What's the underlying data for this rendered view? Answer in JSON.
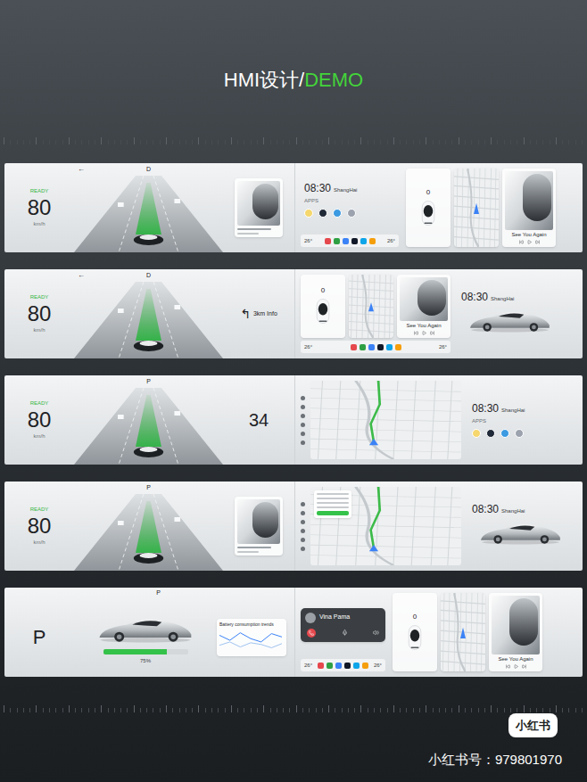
{
  "title": {
    "main": "HMI设计/",
    "accent": "DEMO"
  },
  "dock": {
    "temp_left": "26°",
    "temp_right": "26°",
    "apps": [
      {
        "color": "#e5484d"
      },
      {
        "color": "#2ea043"
      },
      {
        "color": "#3b82f6"
      },
      {
        "color": "#111827"
      },
      {
        "color": "#0ea5e9"
      },
      {
        "color": "#f59e0b"
      }
    ]
  },
  "home_apps": {
    "label": "APPS",
    "apps": [
      {
        "color": "#f5d76e"
      },
      {
        "color": "#1f2937"
      },
      {
        "color": "#3b9ae1"
      },
      {
        "color": "#9ca3af"
      }
    ]
  },
  "screens": [
    {
      "cluster": {
        "kind": "drive",
        "top_gear": "D",
        "arrow": "←",
        "status": "READY",
        "speed": "80",
        "unit": "km/h",
        "widget": {
          "kind": "music"
        }
      },
      "groups": [
        {
          "dock": true,
          "panels": [
            {
              "kind": "home-apps",
              "time": "08:30",
              "city": "ShangHai"
            }
          ]
        },
        {
          "dock": false,
          "panels": [
            {
              "kind": "car-status",
              "value": "0"
            },
            {
              "kind": "map"
            },
            {
              "kind": "music",
              "song": "See You Again"
            }
          ]
        }
      ]
    },
    {
      "cluster": {
        "kind": "drive",
        "top_gear": "D",
        "arrow": "←",
        "status": "READY",
        "speed": "80",
        "unit": "km/h",
        "widget": {
          "kind": "nav",
          "arrow": "↰",
          "text": "3km Info"
        }
      },
      "groups": [
        {
          "dock": true,
          "panels": [
            {
              "kind": "car-status",
              "value": "0"
            },
            {
              "kind": "map"
            },
            {
              "kind": "music",
              "song": "See You Again"
            }
          ]
        },
        {
          "dock": false,
          "panels": [
            {
              "kind": "home-car",
              "time": "08:30",
              "city": "ShangHai"
            }
          ]
        }
      ]
    },
    {
      "cluster": {
        "kind": "drive",
        "top_gear": "P",
        "arrow": "",
        "status": "READY",
        "speed": "80",
        "unit": "km/h",
        "widget": {
          "kind": "number",
          "value": "34"
        }
      },
      "groups": [
        {
          "dock": false,
          "panels": [
            {
              "kind": "big-map",
              "list": false
            }
          ]
        },
        {
          "dock": false,
          "panels": [
            {
              "kind": "home-apps",
              "time": "08:30",
              "city": "ShangHai"
            }
          ]
        }
      ]
    },
    {
      "cluster": {
        "kind": "drive",
        "top_gear": "P",
        "arrow": "",
        "status": "READY",
        "speed": "80",
        "unit": "km/h",
        "widget": {
          "kind": "music"
        }
      },
      "groups": [
        {
          "dock": false,
          "panels": [
            {
              "kind": "big-map",
              "list": true
            }
          ]
        },
        {
          "dock": false,
          "panels": [
            {
              "kind": "home-car",
              "time": "08:30",
              "city": "ShangHai"
            }
          ]
        }
      ]
    },
    {
      "cluster": {
        "kind": "park",
        "top_gear": "P",
        "gear": "P",
        "battery": {
          "level": 0.75,
          "reading": "75%"
        },
        "chart": {
          "title": "Battery consumption trends",
          "series": [
            {
              "values": [
                42,
                36,
                45,
                38,
                34,
                44,
                40
              ],
              "color": "#3b82f6"
            },
            {
              "values": [
                30,
                34,
                28,
                33,
                31,
                27,
                32
              ],
              "color": "#9fc3f0"
            }
          ]
        }
      },
      "groups": [
        {
          "dock": true,
          "panels": [
            {
              "kind": "call",
              "name": "Vina Pama"
            }
          ]
        },
        {
          "dock": false,
          "panels": [
            {
              "kind": "car-status",
              "value": "0"
            },
            {
              "kind": "map"
            },
            {
              "kind": "music",
              "song": "See You Again"
            }
          ]
        }
      ]
    }
  ],
  "footer": {
    "logo": "小红书",
    "account": "小红书号：979801970"
  }
}
